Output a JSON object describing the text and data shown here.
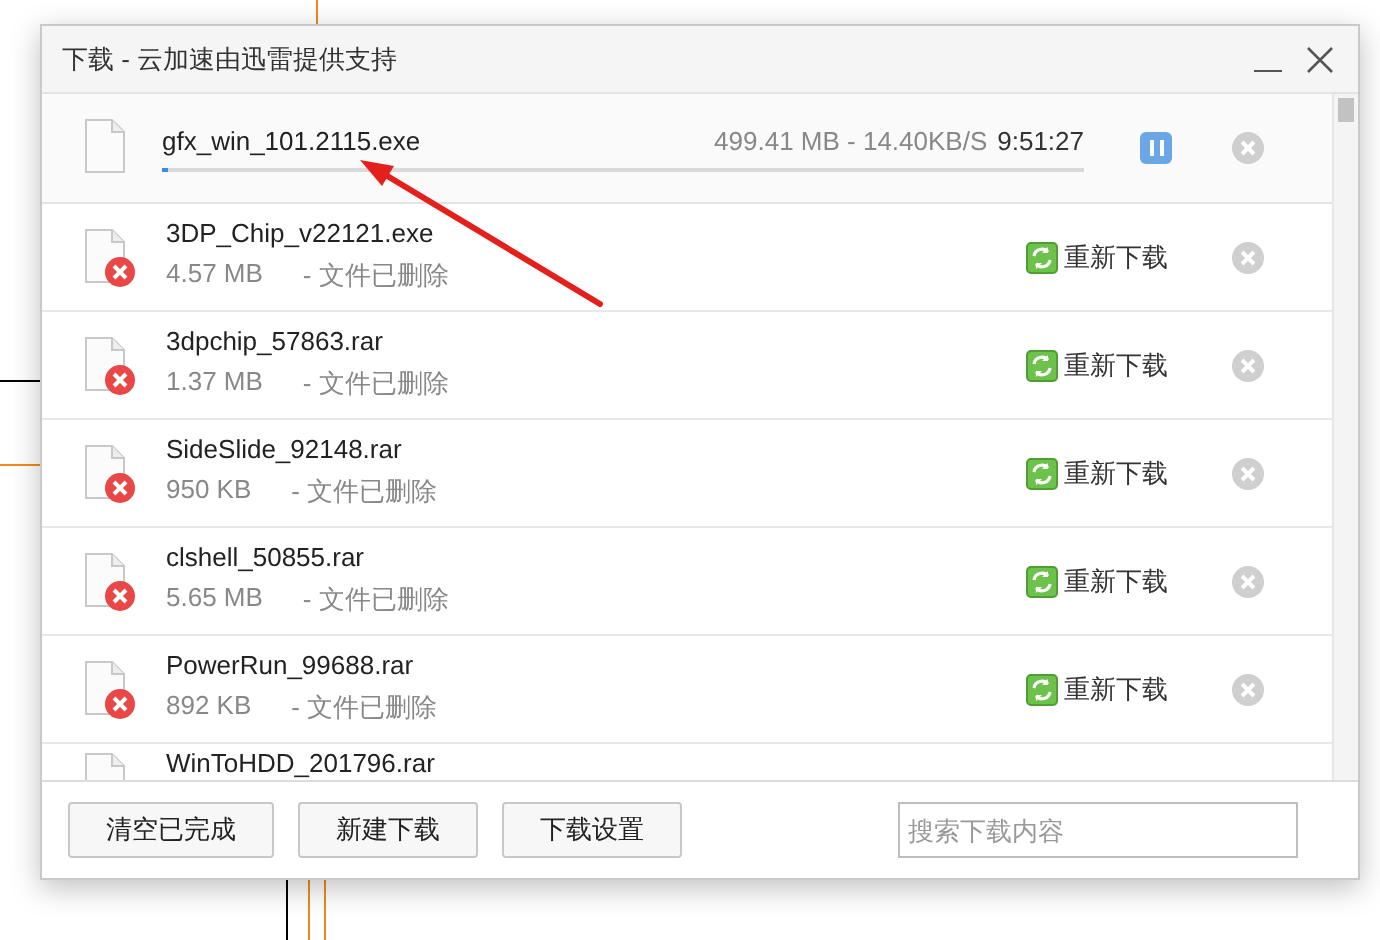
{
  "window": {
    "title": "下载 - 云加速由迅雷提供支持"
  },
  "active_download": {
    "name": "gfx_win_101.2115.exe",
    "info": "499.41 MB - 14.40KB/S",
    "time": "9:51:27",
    "level": 0.006
  },
  "downloads": [
    {
      "name": "3DP_Chip_v22121.exe",
      "size": "4.57 MB",
      "status": "- 文件已删除",
      "action": "重新下载"
    },
    {
      "name": "3dpchip_57863.rar",
      "size": "1.37 MB",
      "status": "- 文件已删除",
      "action": "重新下载"
    },
    {
      "name": "SideSlide_92148.rar",
      "size": "950 KB",
      "status": "- 文件已删除",
      "action": "重新下载"
    },
    {
      "name": "clshell_50855.rar",
      "size": "5.65 MB",
      "status": "- 文件已删除",
      "action": "重新下载"
    },
    {
      "name": "PowerRun_99688.rar",
      "size": "892 KB",
      "status": "- 文件已删除",
      "action": "重新下载"
    },
    {
      "name": "WinToHDD_201796.rar"
    }
  ],
  "buttons": [
    "清空已完成",
    "新建下载",
    "下载设置"
  ],
  "search": {
    "placeholder": "搜索下载内容"
  }
}
